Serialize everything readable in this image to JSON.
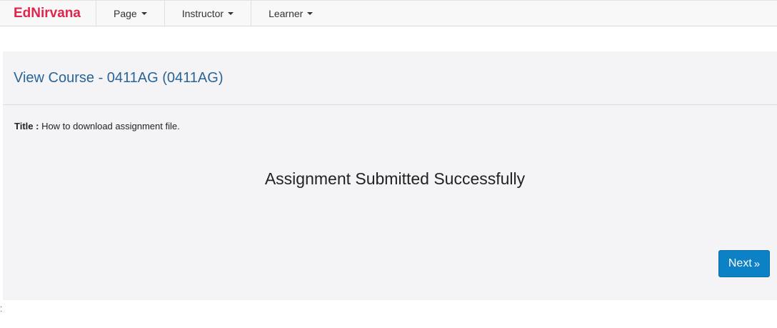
{
  "navbar": {
    "brand": "EdNirvana",
    "items": [
      {
        "label": "Page"
      },
      {
        "label": "Instructor"
      },
      {
        "label": "Learner"
      }
    ]
  },
  "course": {
    "heading": "View Course - 0411AG (0411AG)",
    "title_label": "Title :",
    "title_value": "How to download assignment file."
  },
  "message": "Assignment Submitted Successfully",
  "next_button": {
    "label": "Next",
    "icon": "double-chevron-right-icon"
  },
  "colors": {
    "brand": "#e0254c",
    "heading": "#2a6496",
    "button": "#0d81c6",
    "panel": "#f4f4f6"
  }
}
